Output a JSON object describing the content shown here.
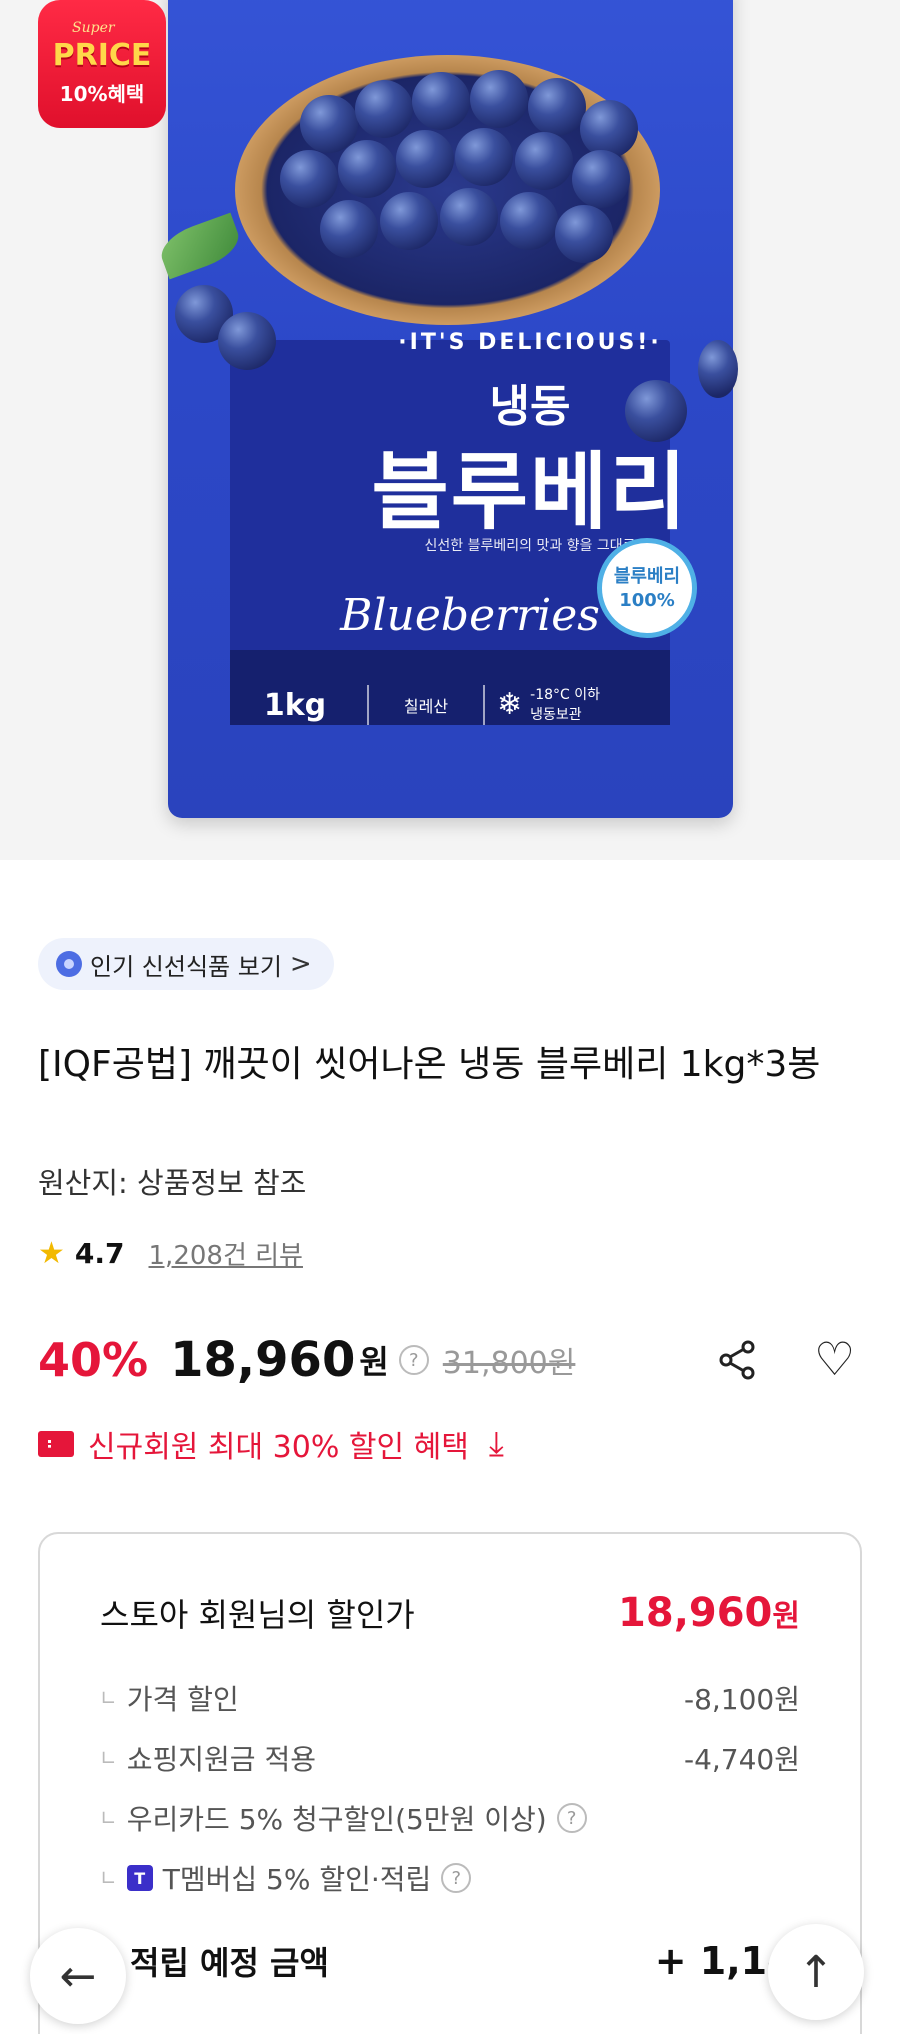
{
  "promo_badge": {
    "super": "Super",
    "price": "PRICE",
    "benefit": "10%혜택"
  },
  "package": {
    "slogan": "·IT'S DELICIOUS!·",
    "frozen": "냉동",
    "product": "블루베리",
    "tagline": "신선한 블루베리의 맛과 향을 그대로",
    "script": "Blueberries",
    "badge_line1": "블루베리",
    "badge_line2": "100%",
    "weight": "1kg",
    "origin": "칠레산",
    "storage_line1": "-18°C 이하",
    "storage_line2": "냉동보관"
  },
  "chip": {
    "label": "인기 신선식품 보기",
    "arrow": ">"
  },
  "product": {
    "title": "[IQF공법] 깨끗이 씻어나온 냉동 블루베리 1kg*3봉",
    "origin": "원산지: 상품정보 참조",
    "rating": "4.7",
    "reviews": "1,208건 리뷰"
  },
  "price": {
    "discount": "40%",
    "sale": "18,960",
    "won": "원",
    "help": "?",
    "original": "31,800원"
  },
  "coupon": {
    "label": "신규회원 최대 30% 할인 혜택"
  },
  "member_box": {
    "label": "스토아 회원님의 할인가",
    "amount": "18,960",
    "unit": "원",
    "lines": [
      {
        "label": "가격 할인",
        "value": "-8,100원"
      },
      {
        "label": "쇼핑지원금 적용",
        "value": "-4,740원"
      },
      {
        "label": "우리카드 5% 청구할인(5만원 이상)",
        "value": ""
      },
      {
        "label": "T멤버십 5% 할인·적립",
        "value": ""
      }
    ],
    "accrue_label": "적립 예정 금액",
    "accrue_value": "+ 1,148"
  },
  "icons": {
    "back": "arrow-left-icon",
    "top": "arrow-up-icon",
    "share": "share-icon",
    "heart": "heart-icon"
  },
  "colors": {
    "accent": "#e5163a",
    "chip_bg": "#eef2fc",
    "pack_blue": "#2c48c8"
  }
}
